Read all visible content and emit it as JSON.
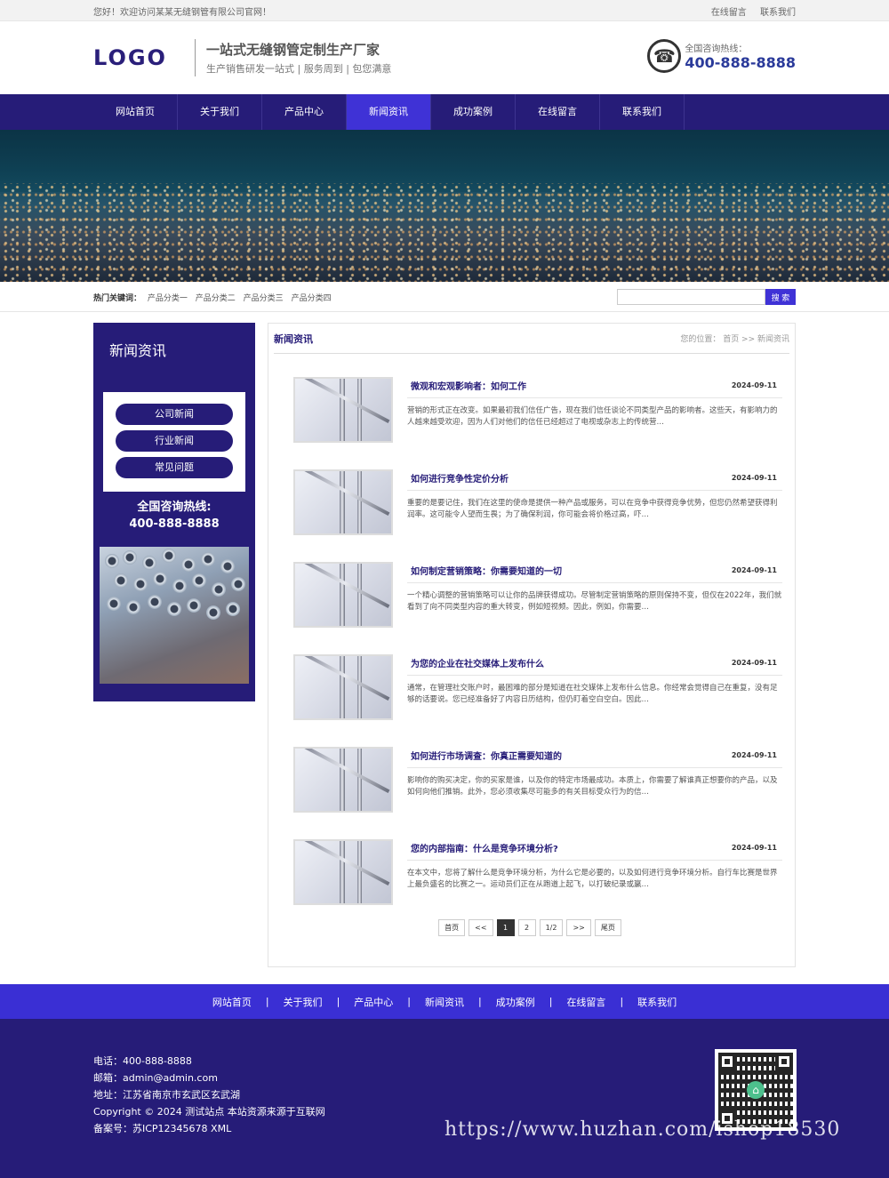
{
  "topbar": {
    "welcome": "您好！欢迎访问某某无缝钢管有限公司官网！",
    "links": [
      "在线留言",
      "联系我们"
    ]
  },
  "header": {
    "logo": "LOGO",
    "slogan_main": "一站式无缝钢管定制生产厂家",
    "slogan_sub": "生产销售研发一站式 | 服务周到 | 包您满意",
    "hotline_label": "全国咨询热线：",
    "hotline_number": "400-888-8888"
  },
  "nav": {
    "items": [
      "网站首页",
      "关于我们",
      "产品中心",
      "新闻资讯",
      "成功案例",
      "在线留言",
      "联系我们"
    ],
    "active": "新闻资讯"
  },
  "search": {
    "hot_label": "热门关键词：",
    "keywords": [
      "产品分类一",
      "产品分类二",
      "产品分类三",
      "产品分类四"
    ],
    "placeholder": "",
    "button": "搜 索"
  },
  "sidebar": {
    "title": "新闻资讯",
    "menu": [
      "公司新闻",
      "行业新闻",
      "常见问题"
    ],
    "hotline_label": "全国咨询热线:",
    "hotline_number": "400-888-8888"
  },
  "content": {
    "title": "新闻资讯",
    "breadcrumb": "您的位置： 首页 >> 新闻资讯",
    "news": [
      {
        "title": "微观和宏观影响者：如何工作",
        "date": "2024-09-11",
        "desc": "营销的形式正在改变。如果最初我们信任广告，现在我们信任谈论不同类型产品的影响者。这些天，有影响力的人越来越受欢迎，因为人们对他们的信任已经超过了电视或杂志上的传统营…"
      },
      {
        "title": "如何进行竞争性定价分析",
        "date": "2024-09-11",
        "desc": "重要的是要记住，我们在这里的使命是提供一种产品或服务，可以在竞争中获得竞争优势，但您仍然希望获得利润率。这可能令人望而生畏；为了确保利润，你可能会将价格过高，吓…"
      },
      {
        "title": "如何制定营销策略：你需要知道的一切",
        "date": "2024-09-11",
        "desc": "一个精心调整的营销策略可以让你的品牌获得成功。尽管制定营销策略的原则保持不变，但仅在2022年，我们就看到了向不同类型内容的重大转变，例如短视频。因此，例如，你需要…"
      },
      {
        "title": "为您的企业在社交媒体上发布什么",
        "date": "2024-09-11",
        "desc": "通常，在管理社交账户时，最困难的部分是知道在社交媒体上发布什么信息。你经常会觉得自己在重复，没有足够的话要说。您已经准备好了内容日历结构，但仍盯着空白空白。因此…"
      },
      {
        "title": "如何进行市场调查：你真正需要知道的",
        "date": "2024-09-11",
        "desc": "影响你的购买决定，你的买家是谁，以及你的特定市场最成功。本质上，你需要了解谁真正想要你的产品，以及如何向他们推销。此外，您必须收集尽可能多的有关目标受众行为的信…"
      },
      {
        "title": "您的内部指南：什么是竞争环境分析?",
        "date": "2024-09-11",
        "desc": "在本文中，您将了解什么是竞争环境分析，为什么它是必要的，以及如何进行竞争环境分析。自行车比赛是世界上最负盛名的比赛之一。运动员们正在从跑道上起飞，以打破纪录或赢…"
      }
    ],
    "pager": [
      "首页",
      "<<",
      "1",
      "2",
      "1/2",
      ">>",
      "尾页"
    ],
    "pager_current": "1"
  },
  "footer": {
    "nav": [
      "网站首页",
      "关于我们",
      "产品中心",
      "新闻资讯",
      "成功案例",
      "在线留言",
      "联系我们"
    ],
    "separator": "|",
    "phone": "电话：400-888-8888",
    "email": "邮箱：admin@admin.com",
    "address": "地址：江苏省南京市玄武区玄武湖",
    "copyright": "Copyright © 2024 测试站点 本站资源来源于互联网",
    "icp": "备案号：苏ICP12345678 XML"
  },
  "watermark": "https://www.huzhan.com/ishop18530",
  "colors": {
    "primary": "#261c78",
    "accent": "#3f32d6",
    "footer_nav": "#3a2fd4"
  },
  "icons": {
    "phone": "phone-icon",
    "qr": "qr-code-icon"
  }
}
